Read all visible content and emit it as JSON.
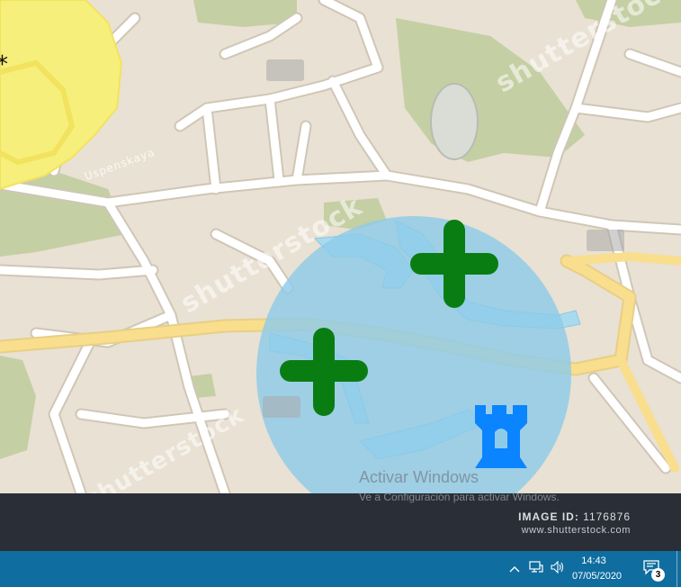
{
  "map": {
    "colors": {
      "land": "#e9e1d3",
      "park": "#c5cfa4",
      "road": "#ffffff",
      "road_edge": "#cfc6b6",
      "main_road": "#f9de8e",
      "water": "#a9dbef",
      "highlight_area": "#f6ef7c",
      "range_circle": "#8ecbe9"
    },
    "markers": [
      {
        "name": "plus-marker-1",
        "icon": "plus-icon",
        "color": "#0a7d12"
      },
      {
        "name": "plus-marker-2",
        "icon": "plus-icon",
        "color": "#0a7d12"
      },
      {
        "name": "tower-marker",
        "icon": "castle-tower-icon",
        "color": "#0a84ff"
      }
    ],
    "street_label": "Uspenskaya"
  },
  "watermark": {
    "text": "shutterstock",
    "image_id_label": "IMAGE ID:",
    "image_id": "1176876",
    "site": "www.shutterstock.com"
  },
  "activation": {
    "title": "Activar Windows",
    "subtitle": "Ve a Configuración para activar Windows."
  },
  "taskbar": {
    "time": "14:43",
    "date": "07/05/2020",
    "notification_count": "3",
    "tray_icons": [
      "chevron-up-icon",
      "network-icon",
      "volume-icon"
    ]
  }
}
